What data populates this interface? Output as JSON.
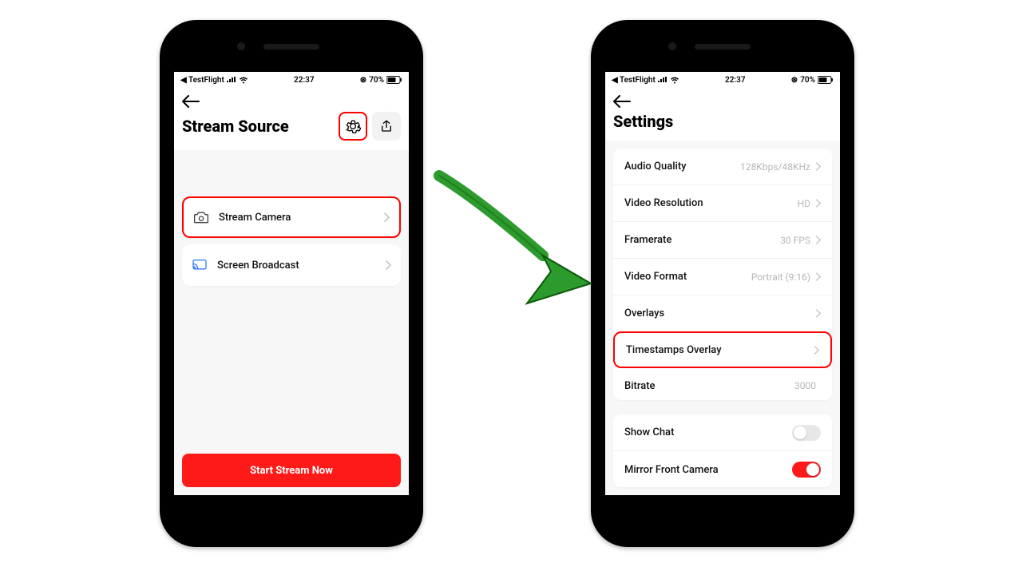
{
  "status": {
    "carrier_prefix": "◀ ",
    "carrier": "TestFlight",
    "time": "22:37",
    "battery_pct": "70%",
    "location_glyph": "⊛"
  },
  "left": {
    "title": "Stream Source",
    "sources": [
      {
        "label": "Stream Camera",
        "icon": "camera-icon"
      },
      {
        "label": "Screen Broadcast",
        "icon": "cast-icon"
      }
    ],
    "cta": "Start Stream Now"
  },
  "right": {
    "title": "Settings",
    "rows": [
      {
        "label": "Audio Quality",
        "value": "128Kbps/48KHz"
      },
      {
        "label": "Video Resolution",
        "value": "HD"
      },
      {
        "label": "Framerate",
        "value": "30 FPS"
      },
      {
        "label": "Video Format",
        "value": "Portrait (9:16)"
      },
      {
        "label": "Overlays",
        "value": ""
      },
      {
        "label": "Timestamps Overlay",
        "value": ""
      },
      {
        "label": "Bitrate",
        "value": "3000"
      }
    ],
    "toggles": [
      {
        "label": "Show Chat",
        "on": false
      },
      {
        "label": "Mirror Front Camera",
        "on": true
      }
    ]
  },
  "annotations": {
    "arrow_color": "#2d9a2d"
  }
}
